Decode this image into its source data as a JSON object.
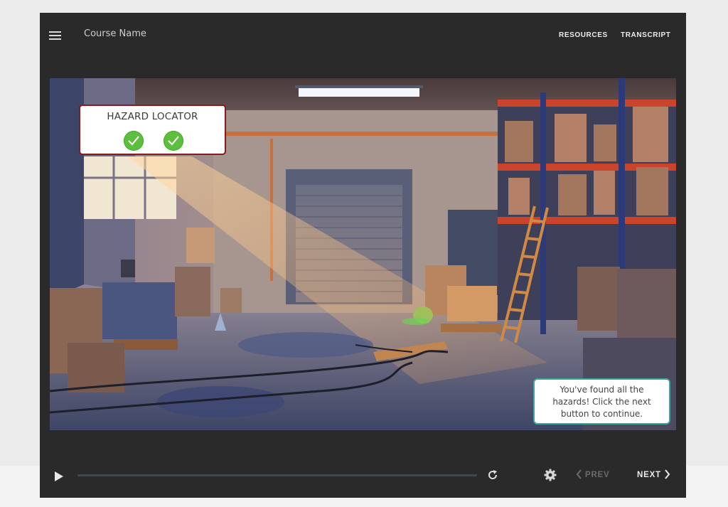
{
  "header": {
    "course_name": "Course Name",
    "links": [
      "RESOURCES",
      "TRANSCRIPT"
    ]
  },
  "slide": {
    "hazard_locator": {
      "title": "HAZARD LOCATOR",
      "found_count": 2,
      "check_icon": "checkmark-icon",
      "check_color": "#5cbf3e"
    },
    "feedback": {
      "text": "You've found all the hazards! Click the next button to continue."
    },
    "scene": "warehouse-illustration"
  },
  "controls": {
    "progress": 0.0,
    "prev_label": "PREV",
    "next_label": "NEXT",
    "icons": [
      "play-icon",
      "replay-icon",
      "gear-icon",
      "chevron-left-icon",
      "chevron-right-icon"
    ]
  },
  "colors": {
    "player_bg": "#2a2a2a",
    "hazard_border": "#8b1a1a",
    "feedback_border": "#3aa7a0",
    "accent_shelf": "#c9442a"
  }
}
